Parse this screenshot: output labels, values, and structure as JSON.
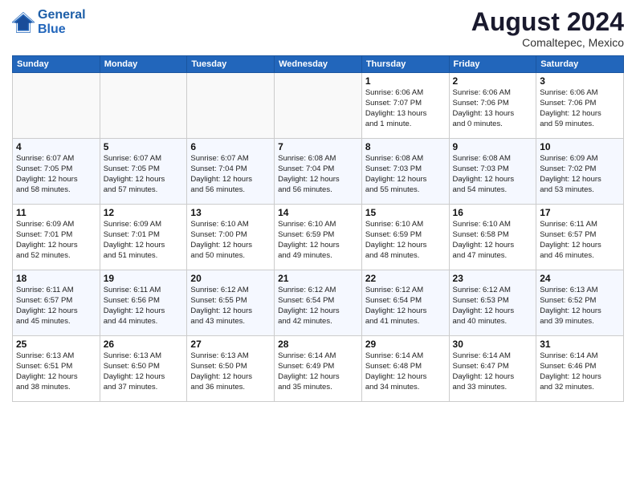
{
  "logo": {
    "line1": "General",
    "line2": "Blue"
  },
  "title": "August 2024",
  "subtitle": "Comaltepec, Mexico",
  "days_of_week": [
    "Sunday",
    "Monday",
    "Tuesday",
    "Wednesday",
    "Thursday",
    "Friday",
    "Saturday"
  ],
  "weeks": [
    [
      {
        "day": "",
        "info": ""
      },
      {
        "day": "",
        "info": ""
      },
      {
        "day": "",
        "info": ""
      },
      {
        "day": "",
        "info": ""
      },
      {
        "day": "1",
        "info": "Sunrise: 6:06 AM\nSunset: 7:07 PM\nDaylight: 13 hours\nand 1 minute."
      },
      {
        "day": "2",
        "info": "Sunrise: 6:06 AM\nSunset: 7:06 PM\nDaylight: 13 hours\nand 0 minutes."
      },
      {
        "day": "3",
        "info": "Sunrise: 6:06 AM\nSunset: 7:06 PM\nDaylight: 12 hours\nand 59 minutes."
      }
    ],
    [
      {
        "day": "4",
        "info": "Sunrise: 6:07 AM\nSunset: 7:05 PM\nDaylight: 12 hours\nand 58 minutes."
      },
      {
        "day": "5",
        "info": "Sunrise: 6:07 AM\nSunset: 7:05 PM\nDaylight: 12 hours\nand 57 minutes."
      },
      {
        "day": "6",
        "info": "Sunrise: 6:07 AM\nSunset: 7:04 PM\nDaylight: 12 hours\nand 56 minutes."
      },
      {
        "day": "7",
        "info": "Sunrise: 6:08 AM\nSunset: 7:04 PM\nDaylight: 12 hours\nand 56 minutes."
      },
      {
        "day": "8",
        "info": "Sunrise: 6:08 AM\nSunset: 7:03 PM\nDaylight: 12 hours\nand 55 minutes."
      },
      {
        "day": "9",
        "info": "Sunrise: 6:08 AM\nSunset: 7:03 PM\nDaylight: 12 hours\nand 54 minutes."
      },
      {
        "day": "10",
        "info": "Sunrise: 6:09 AM\nSunset: 7:02 PM\nDaylight: 12 hours\nand 53 minutes."
      }
    ],
    [
      {
        "day": "11",
        "info": "Sunrise: 6:09 AM\nSunset: 7:01 PM\nDaylight: 12 hours\nand 52 minutes."
      },
      {
        "day": "12",
        "info": "Sunrise: 6:09 AM\nSunset: 7:01 PM\nDaylight: 12 hours\nand 51 minutes."
      },
      {
        "day": "13",
        "info": "Sunrise: 6:10 AM\nSunset: 7:00 PM\nDaylight: 12 hours\nand 50 minutes."
      },
      {
        "day": "14",
        "info": "Sunrise: 6:10 AM\nSunset: 6:59 PM\nDaylight: 12 hours\nand 49 minutes."
      },
      {
        "day": "15",
        "info": "Sunrise: 6:10 AM\nSunset: 6:59 PM\nDaylight: 12 hours\nand 48 minutes."
      },
      {
        "day": "16",
        "info": "Sunrise: 6:10 AM\nSunset: 6:58 PM\nDaylight: 12 hours\nand 47 minutes."
      },
      {
        "day": "17",
        "info": "Sunrise: 6:11 AM\nSunset: 6:57 PM\nDaylight: 12 hours\nand 46 minutes."
      }
    ],
    [
      {
        "day": "18",
        "info": "Sunrise: 6:11 AM\nSunset: 6:57 PM\nDaylight: 12 hours\nand 45 minutes."
      },
      {
        "day": "19",
        "info": "Sunrise: 6:11 AM\nSunset: 6:56 PM\nDaylight: 12 hours\nand 44 minutes."
      },
      {
        "day": "20",
        "info": "Sunrise: 6:12 AM\nSunset: 6:55 PM\nDaylight: 12 hours\nand 43 minutes."
      },
      {
        "day": "21",
        "info": "Sunrise: 6:12 AM\nSunset: 6:54 PM\nDaylight: 12 hours\nand 42 minutes."
      },
      {
        "day": "22",
        "info": "Sunrise: 6:12 AM\nSunset: 6:54 PM\nDaylight: 12 hours\nand 41 minutes."
      },
      {
        "day": "23",
        "info": "Sunrise: 6:12 AM\nSunset: 6:53 PM\nDaylight: 12 hours\nand 40 minutes."
      },
      {
        "day": "24",
        "info": "Sunrise: 6:13 AM\nSunset: 6:52 PM\nDaylight: 12 hours\nand 39 minutes."
      }
    ],
    [
      {
        "day": "25",
        "info": "Sunrise: 6:13 AM\nSunset: 6:51 PM\nDaylight: 12 hours\nand 38 minutes."
      },
      {
        "day": "26",
        "info": "Sunrise: 6:13 AM\nSunset: 6:50 PM\nDaylight: 12 hours\nand 37 minutes."
      },
      {
        "day": "27",
        "info": "Sunrise: 6:13 AM\nSunset: 6:50 PM\nDaylight: 12 hours\nand 36 minutes."
      },
      {
        "day": "28",
        "info": "Sunrise: 6:14 AM\nSunset: 6:49 PM\nDaylight: 12 hours\nand 35 minutes."
      },
      {
        "day": "29",
        "info": "Sunrise: 6:14 AM\nSunset: 6:48 PM\nDaylight: 12 hours\nand 34 minutes."
      },
      {
        "day": "30",
        "info": "Sunrise: 6:14 AM\nSunset: 6:47 PM\nDaylight: 12 hours\nand 33 minutes."
      },
      {
        "day": "31",
        "info": "Sunrise: 6:14 AM\nSunset: 6:46 PM\nDaylight: 12 hours\nand 32 minutes."
      }
    ]
  ]
}
